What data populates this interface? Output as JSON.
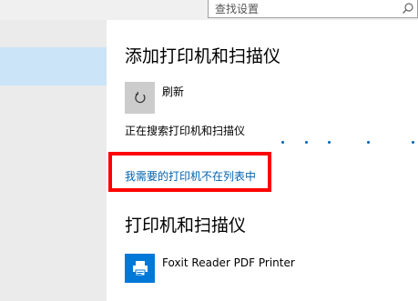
{
  "search": {
    "placeholder": "查找设置"
  },
  "add_section": {
    "title": "添加打印机和扫描仪",
    "refresh_label": "刷新",
    "searching_text": "正在搜索打印机和扫描仪",
    "missing_printer_link": "我需要的打印机不在列表中"
  },
  "printers_section": {
    "title": "打印机和扫描仪",
    "items": [
      {
        "name": "Foxit Reader PDF Printer",
        "icon": "printer-icon"
      }
    ]
  },
  "colors": {
    "accent": "#0078d7",
    "link": "#0063b1",
    "highlight": "#ff0000",
    "sidebar_selected": "#cce4f7"
  }
}
